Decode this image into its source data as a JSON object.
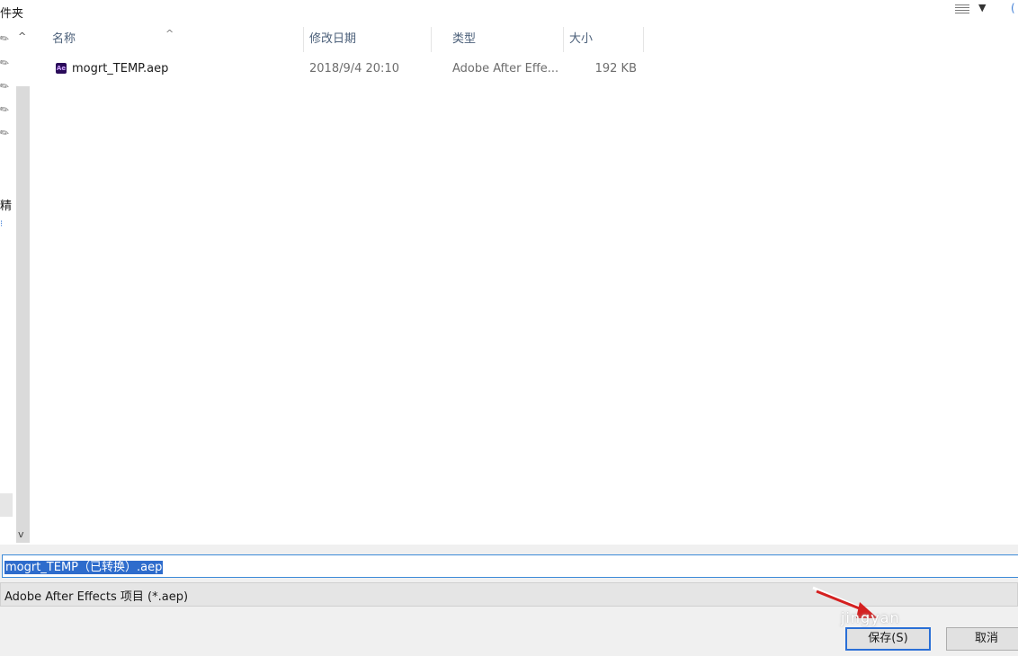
{
  "toolbar": {
    "breadcrumb_fragment": "件夹",
    "view_icon": "details-view-icon",
    "view_dropdown": "▼"
  },
  "nav": {
    "pin_icon": "pin-icon",
    "partial_label": "精",
    "scroll_up": "^",
    "scroll_down": "v"
  },
  "columns": {
    "name": "名称",
    "date": "修改日期",
    "type": "类型",
    "size": "大小",
    "sort_indicator": "^"
  },
  "files": [
    {
      "icon": "ae-file-icon",
      "icon_text": "Ae",
      "name": "mogrt_TEMP.aep",
      "date": "2018/9/4 20:10",
      "type": "Adobe After Effe...",
      "size": "192 KB"
    }
  ],
  "save_form": {
    "filename": "mogrt_TEMP（已转换）.aep",
    "filetype": "Adobe After Effects 项目 (*.aep)"
  },
  "buttons": {
    "save": "保存(S)",
    "cancel": "取消"
  },
  "watermark": "jingyan",
  "colors": {
    "selection": "#2e6ccc",
    "focus_border": "#2a6fd6",
    "header_text": "#4c607a",
    "ae_icon": "#2a0b5a",
    "arrow": "#d42020"
  }
}
